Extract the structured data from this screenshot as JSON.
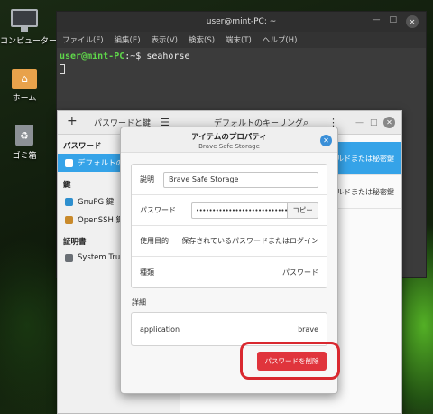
{
  "desktop": {
    "icons": [
      {
        "label": "コンピューター",
        "icon": "computer-icon"
      },
      {
        "label": "ホーム",
        "icon": "home-folder-icon"
      },
      {
        "label": "ゴミ箱",
        "icon": "trash-icon"
      }
    ]
  },
  "terminal": {
    "title": "user@mint-PC: ~",
    "menu": [
      "ファイル(F)",
      "編集(E)",
      "表示(V)",
      "検索(S)",
      "端末(T)",
      "ヘルプ(H)"
    ],
    "prompt_user": "user@mint-PC",
    "prompt_rest": ":~$ seahorse"
  },
  "seahorse": {
    "header_left": "パスワードと鍵",
    "header_center": "デフォルトのキーリング",
    "sidebar": {
      "section_passwords": "パスワード",
      "item_default_keyring": "デフォルトのキ",
      "section_keys": "鍵",
      "item_gnupg": "GnuPG 鍵",
      "item_openssh": "OpenSSH 鍵",
      "section_certs": "証明書",
      "item_system_trust": "System Trust"
    },
    "list": [
      {
        "text": "ルドまたは秘密鍵"
      },
      {
        "text": "ルドまたは秘密鍵"
      }
    ]
  },
  "dialog": {
    "title": "アイテムのプロパティ",
    "subtitle": "Brave Safe Storage",
    "desc_label": "説明",
    "desc_value": "Brave Safe Storage",
    "password_label": "パスワード",
    "password_value": "••••••••••••••••••••••••••••",
    "copy_label": "コピー",
    "purpose_label": "使用目的",
    "purpose_value": "保存されているパスワードまたはログイン",
    "type_label": "種類",
    "type_value": "パスワード",
    "details_label": "詳細",
    "app_label": "application",
    "app_value": "brave",
    "delete_label": "パスワードを削除"
  }
}
